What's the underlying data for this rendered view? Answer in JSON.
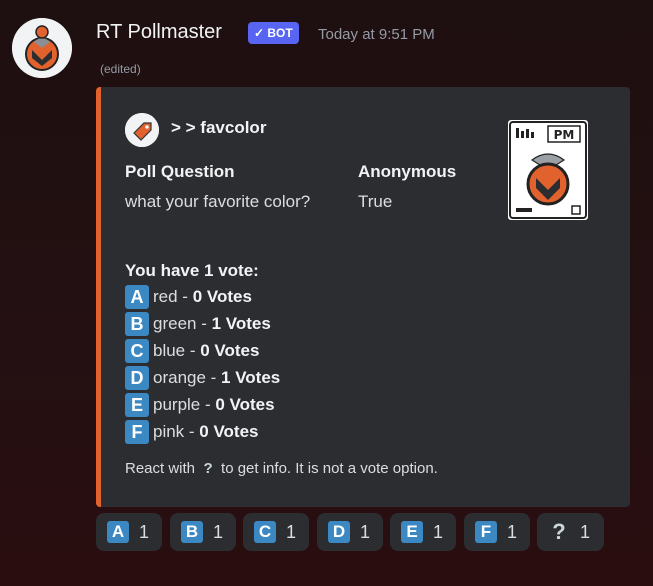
{
  "message": {
    "username": "RT Pollmaster",
    "bot_badge": "✓ BOT",
    "timestamp": "Today at 9:51 PM",
    "edited": "(edited)"
  },
  "embed": {
    "accent_color": "#e2622e",
    "author": "> > favcolor",
    "thumbnail_label": "PM",
    "fields": [
      {
        "name": "Poll Question",
        "value": "what your favorite color?"
      },
      {
        "name": "Anonymous",
        "value": "True"
      }
    ],
    "votes_heading": "You have 1 vote:",
    "options": [
      {
        "letter": "A",
        "name": "red",
        "sep": " - ",
        "count": "0 Votes"
      },
      {
        "letter": "B",
        "name": "green",
        "sep": " - ",
        "count": "1 Votes"
      },
      {
        "letter": "C",
        "name": "blue",
        "sep": " - ",
        "count": "0 Votes"
      },
      {
        "letter": "D",
        "name": "orange",
        "sep": " - ",
        "count": "1 Votes"
      },
      {
        "letter": "E",
        "name": "purple",
        "sep": " - ",
        "count": "0 Votes"
      },
      {
        "letter": "F",
        "name": "pink",
        "sep": " - ",
        "count": "0 Votes"
      }
    ],
    "info_before": "React with",
    "info_icon": "?",
    "info_after": "to get info. It is not a vote option."
  },
  "reactions": [
    {
      "emoji": "A",
      "count": "1"
    },
    {
      "emoji": "B",
      "count": "1"
    },
    {
      "emoji": "C",
      "count": "1"
    },
    {
      "emoji": "D",
      "count": "1"
    },
    {
      "emoji": "E",
      "count": "1"
    },
    {
      "emoji": "F",
      "count": "1"
    },
    {
      "emoji": "?",
      "count": "1"
    }
  ]
}
